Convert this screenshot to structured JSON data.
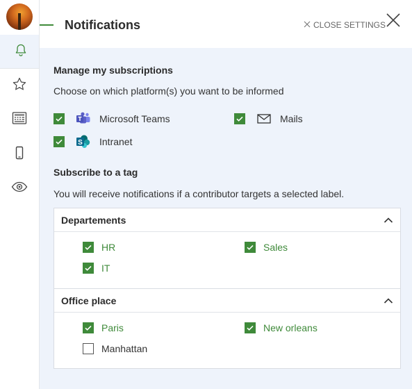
{
  "header": {
    "title": "Notifications",
    "close_settings_label": "CLOSE SETTINGS"
  },
  "rail": {
    "items": [
      {
        "icon": "bell-icon",
        "active": true
      },
      {
        "icon": "star-icon",
        "active": false
      },
      {
        "icon": "news-icon",
        "active": false
      },
      {
        "icon": "mobile-icon",
        "active": false
      },
      {
        "icon": "eye-icon",
        "active": false
      }
    ]
  },
  "subscriptions": {
    "heading": "Manage my subscriptions",
    "description": "Choose on which platform(s) you want to be informed",
    "platforms": [
      {
        "label": "Microsoft Teams",
        "icon": "teams-icon",
        "checked": true
      },
      {
        "label": "Mails",
        "icon": "mail-icon",
        "checked": true
      },
      {
        "label": "Intranet",
        "icon": "sharepoint-icon",
        "checked": true
      }
    ]
  },
  "tags": {
    "heading": "Subscribe to a tag",
    "description": "You will receive notifications if a contributor targets a selected label.",
    "groups": [
      {
        "title": "Departements",
        "expanded": true,
        "items": [
          {
            "label": "HR",
            "checked": true
          },
          {
            "label": "Sales",
            "checked": true
          },
          {
            "label": "IT",
            "checked": true
          }
        ]
      },
      {
        "title": "Office place",
        "expanded": true,
        "items": [
          {
            "label": "Paris",
            "checked": true
          },
          {
            "label": "New orleans",
            "checked": true
          },
          {
            "label": "Manhattan",
            "checked": false
          }
        ]
      }
    ]
  },
  "colors": {
    "accent_green": "#3f8a3a",
    "panel_bg": "#eef3fb",
    "teams_purple": "#5b5fc7",
    "sharepoint_blue": "#0b6a8e"
  }
}
